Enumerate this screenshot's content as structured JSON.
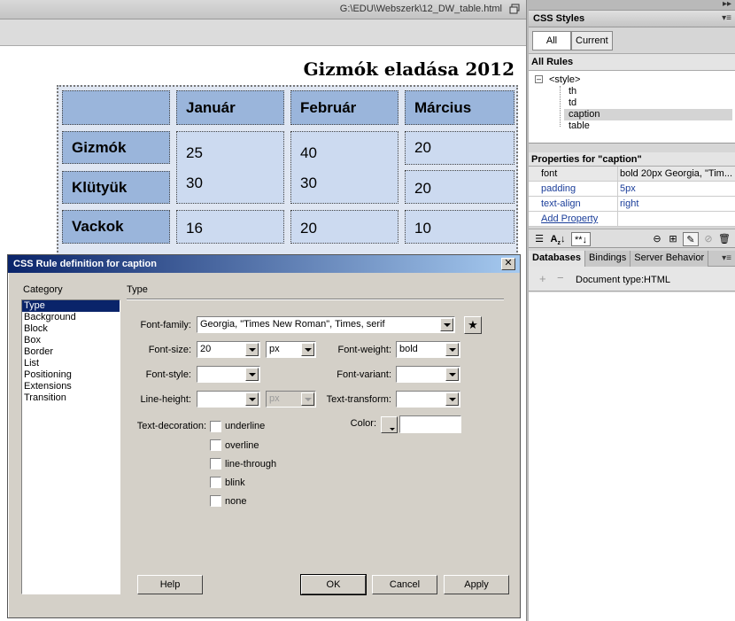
{
  "document": {
    "path": "G:\\EDU\\Webszerk\\12_DW_table.html",
    "caption": "Gizmók eladása 2012",
    "headers": [
      "",
      "Január",
      "Február",
      "Március"
    ],
    "rows": [
      {
        "label": "Gizmók",
        "values": [
          "25",
          "40",
          "20"
        ]
      },
      {
        "label": "Klütyük",
        "values": [
          "30",
          "30",
          "20"
        ]
      },
      {
        "label": "Vackok",
        "values": [
          "16",
          "20",
          "10"
        ]
      }
    ]
  },
  "dialog": {
    "title": "CSS Rule definition for caption",
    "close": "✕",
    "category_label": "Category",
    "section_title": "Type",
    "categories": [
      "Type",
      "Background",
      "Block",
      "Box",
      "Border",
      "List",
      "Positioning",
      "Extensions",
      "Transition"
    ],
    "fields": {
      "font_family_label": "Font-family:",
      "font_family_value": "Georgia, \"Times New Roman\", Times, serif",
      "font_size_label": "Font-size:",
      "font_size_value": "20",
      "font_size_unit": "px",
      "font_weight_label": "Font-weight:",
      "font_weight_value": "bold",
      "font_style_label": "Font-style:",
      "font_style_value": "",
      "font_variant_label": "Font-variant:",
      "font_variant_value": "",
      "line_height_label": "Line-height:",
      "line_height_value": "",
      "line_height_unit": "px",
      "text_transform_label": "Text-transform:",
      "text_transform_value": "",
      "text_decoration_label": "Text-decoration:",
      "color_label": "Color:",
      "color_value": ""
    },
    "decorations": [
      "underline",
      "overline",
      "line-through",
      "blink",
      "none"
    ],
    "buttons": {
      "help": "Help",
      "ok": "OK",
      "cancel": "Cancel",
      "apply": "Apply"
    }
  },
  "panel": {
    "title": "CSS Styles",
    "tab_all": "All",
    "tab_current": "Current",
    "all_rules": "All Rules",
    "tree": {
      "root": "<style>",
      "items": [
        "th",
        "td",
        "caption",
        "table"
      ]
    },
    "props_title": "Properties for \"caption\"",
    "properties": [
      {
        "name": "font",
        "value": "bold 20px Georgia, \"Tim..."
      },
      {
        "name": "padding",
        "value": "5px"
      },
      {
        "name": "text-align",
        "value": "right"
      },
      {
        "name": "Add Property",
        "value": ""
      }
    ],
    "db_tabs": [
      "Databases",
      "Bindings",
      "Server Behavior"
    ],
    "doc_type": "Document type:HTML",
    "menu_icon": "▾≡",
    "expand_icon": "▸▸",
    "minus": "–"
  },
  "colors": {
    "th_bg": "#9ab5db",
    "td_bg": "#ccdaf0",
    "dialog_title_start": "#0a246a",
    "dialog_title_end": "#a6caf0",
    "selection": "#0a246a"
  }
}
